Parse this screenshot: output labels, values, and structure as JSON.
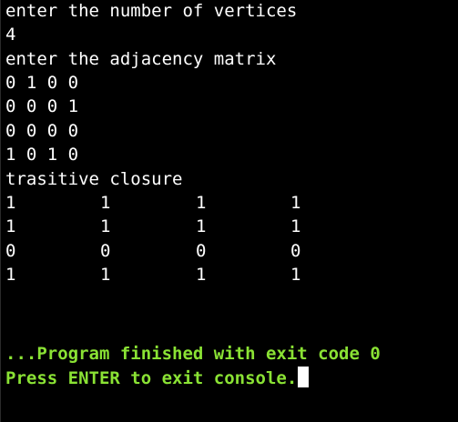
{
  "console": {
    "lines": [
      "enter the number of vertices",
      "4",
      "enter the adjacency matrix",
      "0 1 0 0",
      "0 0 0 1",
      "0 0 0 0",
      "1 0 1 0",
      "trasitive closure"
    ],
    "closure_rows": [
      [
        "1",
        "1",
        "1",
        "1"
      ],
      [
        "1",
        "1",
        "1",
        "1"
      ],
      [
        "0",
        "0",
        "0",
        "0"
      ],
      [
        "1",
        "1",
        "1",
        "1"
      ]
    ],
    "finished_message": "...Program finished with exit code 0",
    "prompt_message": "Press ENTER to exit console."
  },
  "colors": {
    "background": "#000000",
    "text": "#ffffff",
    "status": "#8ae234"
  }
}
